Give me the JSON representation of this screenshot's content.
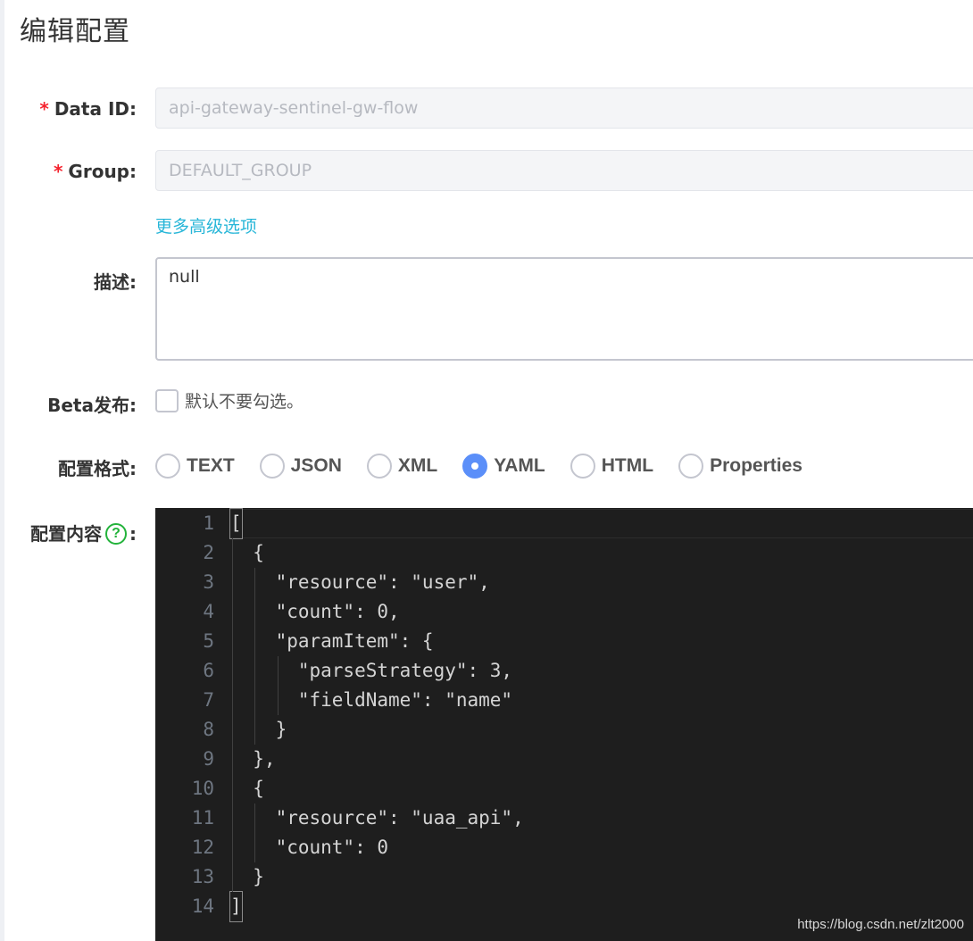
{
  "page": {
    "title": "编辑配置"
  },
  "form": {
    "required_mark": "*",
    "data_id": {
      "label": "Data ID:",
      "value": "api-gateway-sentinel-gw-flow"
    },
    "group": {
      "label": "Group:",
      "value": "DEFAULT_GROUP"
    },
    "more_options_link": "更多高级选项",
    "description": {
      "label": "描述:",
      "value": "null"
    },
    "beta": {
      "label": "Beta发布:",
      "checkbox_text": "默认不要勾选。",
      "checked": false
    },
    "format": {
      "label": "配置格式:",
      "options": [
        "TEXT",
        "JSON",
        "XML",
        "YAML",
        "HTML",
        "Properties"
      ],
      "selected": "YAML"
    },
    "content": {
      "label": "配置内容",
      "help_icon": "question-circle-icon",
      "help_glyph": "?",
      "colon": ":"
    }
  },
  "editor": {
    "lines": [
      "[",
      "  {",
      "    \"resource\": \"user\",",
      "    \"count\": 0,",
      "    \"paramItem\": {",
      "      \"parseStrategy\": 3,",
      "      \"fieldName\": \"name\"",
      "    }",
      "  },",
      "  {",
      "    \"resource\": \"uaa_api\",",
      "    \"count\": 0",
      "  }",
      "]"
    ],
    "line_numbers": [
      "1",
      "2",
      "3",
      "4",
      "5",
      "6",
      "7",
      "8",
      "9",
      "10",
      "11",
      "12",
      "13",
      "14"
    ]
  },
  "watermark": "https://blog.csdn.net/zlt2000",
  "colors": {
    "accent_blue": "#5b8ff9",
    "link": "#27b6d8",
    "required": "#f5222d",
    "help": "#23b33b",
    "editor_bg": "#1e1e1e"
  }
}
